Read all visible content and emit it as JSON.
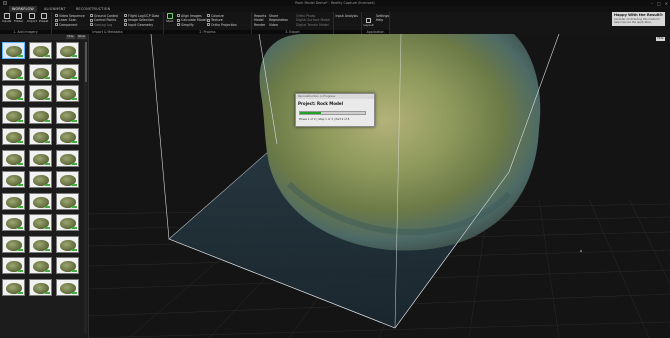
{
  "window": {
    "title": "Rock Model Demo* - Reality Capture (licensed)"
  },
  "ribbon_tabs": [
    {
      "label": "WORKFLOW",
      "active": true
    },
    {
      "label": "ALIGNMENT",
      "active": false
    },
    {
      "label": "RECONSTRUCTION",
      "active": false
    }
  ],
  "ribbon": {
    "groups": [
      {
        "label": "1. Add Imagery"
      },
      {
        "label": "Import & Metadata"
      },
      {
        "label": "2. Process"
      },
      {
        "label": "3. Export"
      },
      {
        "label": "Application"
      }
    ],
    "add_imagery_buttons": [
      "Inputs",
      "Folder",
      "Import",
      "Preset"
    ],
    "import_items": [
      "Video Sequence",
      "Laser Scan",
      "Component",
      "Ground Control",
      "Control Points",
      "Geotag Log",
      "Flight Log",
      "Image Selection",
      "Input Geometry",
      "GCP Data"
    ],
    "process_buttons": [
      "Start"
    ],
    "process_items": [
      "Align Images",
      "Calculate Model",
      "Simplify",
      "Colorize",
      "Texture",
      "Ortho Projection"
    ],
    "export_buttons": [
      "Reports"
    ],
    "export_items": [
      "Model",
      "Share",
      "Render",
      "Registration",
      "Video",
      "Ortho Photo",
      "Digital Surface Model",
      "Digital Terrain Model",
      "Input Analysis"
    ],
    "app_buttons": [
      "Layout",
      "Settings",
      "Help"
    ]
  },
  "notification": {
    "title": "Happy With the Result?",
    "body": "Consider contributing this model to help improve the application."
  },
  "left_panel": {
    "buttons": [
      "Hide",
      "Show"
    ],
    "thumbnail_count": 36,
    "selected_index": 0
  },
  "viewport": {
    "corner_button": "Hide"
  },
  "progress_dialog": {
    "header": "Reconstruction in Progress",
    "title": "Project: Rock Model",
    "progress": 0.32,
    "status": "Phase 1 of 2  |  Step 1 of 3  |  Part 4 of 8"
  },
  "colors": {
    "background": "#0f0f0f",
    "progress": "#23a12c",
    "accent": "#5bb3ff"
  }
}
